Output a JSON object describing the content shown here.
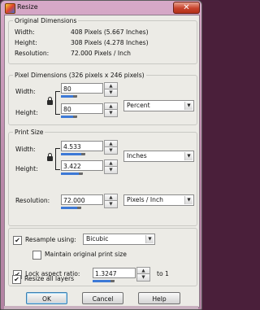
{
  "window": {
    "title": "Resize",
    "close_glyph": "✕"
  },
  "original": {
    "legend": "Original Dimensions",
    "rows": [
      {
        "label": "Width:",
        "value": "408 Pixels (5.667 Inches)"
      },
      {
        "label": "Height:",
        "value": "308 Pixels (4.278 Inches)"
      },
      {
        "label": "Resolution:",
        "value": "72.000 Pixels / Inch"
      }
    ]
  },
  "pixel": {
    "legend": "Pixel Dimensions (326 pixels x 246 pixels)",
    "width_label": "Width:",
    "width_value": "80",
    "width_fraction": 0.33,
    "height_label": "Height:",
    "height_value": "80",
    "height_fraction": 0.33,
    "unit": "Percent"
  },
  "print": {
    "legend": "Print Size",
    "width_label": "Width:",
    "width_value": "4.533",
    "width_fraction": 0.5,
    "height_label": "Height:",
    "height_value": "3.422",
    "height_fraction": 0.45,
    "unit": "Inches",
    "resolution_label": "Resolution:",
    "resolution_value": "72.000",
    "resolution_fraction": 0.42,
    "resolution_unit": "Pixels / Inch"
  },
  "options": {
    "resample_label": "Resample using:",
    "resample_checked": true,
    "resample_method": "Bicubic",
    "maintain_label": "Maintain original print size",
    "maintain_checked": false,
    "lock_label": "Lock aspect ratio:",
    "lock_checked": true,
    "lock_value": "1.3247",
    "lock_suffix": "to 1",
    "lock_fraction": 0.45,
    "resize_layers_label": "Resize all layers",
    "resize_layers_checked": true
  },
  "buttons": {
    "ok": "OK",
    "cancel": "Cancel",
    "help": "Help"
  },
  "icons": {
    "lock": "lock-icon",
    "spin_up": "▲",
    "spin_down": "▼",
    "dropdown": "▼",
    "check": "✔"
  },
  "colors": {
    "accent": "#3d79d6",
    "title_bar": "#c999b9"
  }
}
